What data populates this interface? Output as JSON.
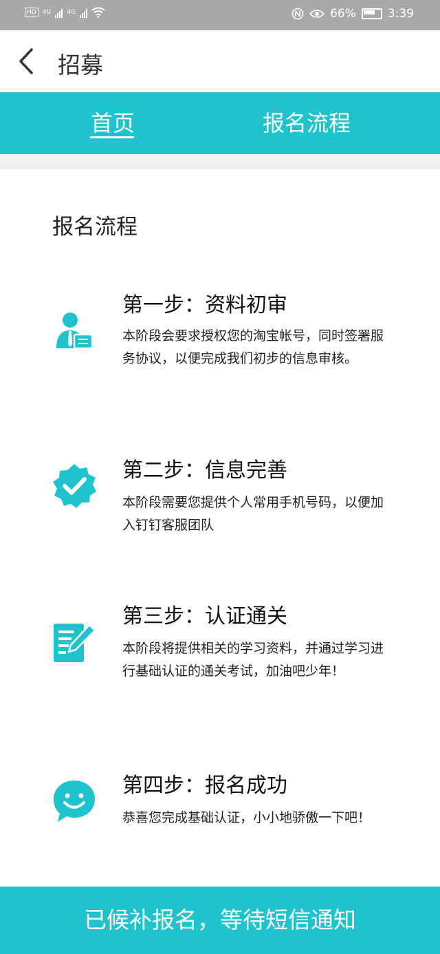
{
  "status_bar": {
    "left_badges": [
      "HD",
      "4G",
      "4G"
    ],
    "battery_percent": "66%",
    "time": "3:39"
  },
  "header": {
    "title": "招募"
  },
  "tabs": [
    {
      "label": "首页",
      "active": true
    },
    {
      "label": "报名流程",
      "active": false
    }
  ],
  "section_title": "报名流程",
  "steps": [
    {
      "icon": "user-card-icon",
      "title": "第一步：资料初审",
      "description": "本阶段会要求授权您的淘宝帐号，同时签署服务协议，以便完成我们初步的信息审核。"
    },
    {
      "icon": "verified-badge-icon",
      "title": "第二步：信息完善",
      "description": "本阶段需要您提供个人常用手机号码，以便加入钉钉客服团队"
    },
    {
      "icon": "edit-document-icon",
      "title": "第三步：认证通关",
      "description": "本阶段将提供相关的学习资料，并通过学习进行基础认证的通关考试，加油吧少年！"
    },
    {
      "icon": "smile-chat-icon",
      "title": "第四步：报名成功",
      "description": "恭喜您完成基础认证，小小地骄傲一下吧！"
    }
  ],
  "bottom_button": {
    "label": "已候补报名，等待短信通知"
  },
  "colors": {
    "accent": "#1fc3cd",
    "status_bar": "#a9a9a9"
  }
}
